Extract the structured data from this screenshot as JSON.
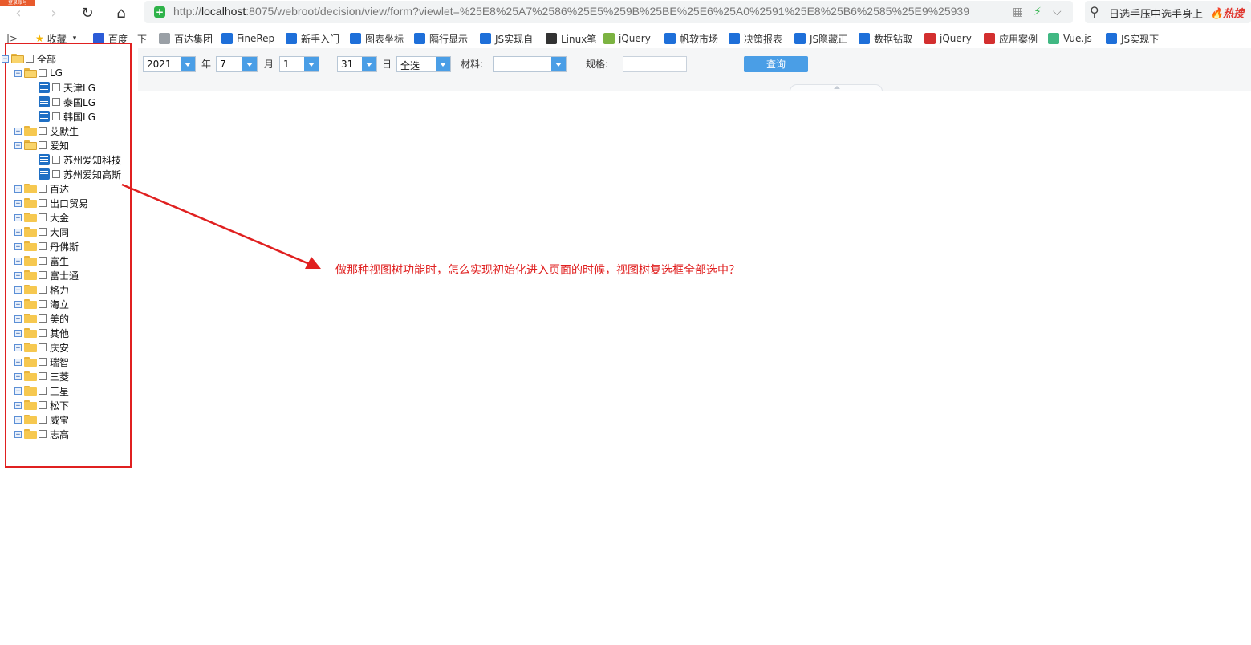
{
  "browser": {
    "login_badge": "登录账号",
    "url_prefix": "http://",
    "url_host": "localhost",
    "url_rest": ":8075/webroot/decision/view/form?viewlet=%25E8%25A7%2586%25E5%259B%25BE%25E6%25A0%2591%25E8%25B6%2585%25E9%25939",
    "search_text": "日选手压中选手身上",
    "search_hot": "🔥热搜"
  },
  "bookmarks": {
    "collect_label": "收藏",
    "items": [
      {
        "label": "百度一下",
        "color": "#2b5bd7"
      },
      {
        "label": "百达集团",
        "color": "#9aa0a6"
      },
      {
        "label": "FineRep",
        "color": "#1e6fd9"
      },
      {
        "label": "新手入门",
        "color": "#1e6fd9"
      },
      {
        "label": "图表坐标",
        "color": "#1e6fd9"
      },
      {
        "label": "隔行显示",
        "color": "#1e6fd9"
      },
      {
        "label": "JS实现自",
        "color": "#1e6fd9"
      },
      {
        "label": "Linux笔",
        "color": "#333333"
      },
      {
        "label": "jQuery",
        "color": "#7cb342"
      },
      {
        "label": "帆软市场",
        "color": "#1e6fd9"
      },
      {
        "label": "决策报表",
        "color": "#1e6fd9"
      },
      {
        "label": "JS隐藏正",
        "color": "#1e6fd9"
      },
      {
        "label": "数据钻取",
        "color": "#1e6fd9"
      },
      {
        "label": "jQuery",
        "color": "#d32f2f"
      },
      {
        "label": "应用案例",
        "color": "#d32f2f"
      },
      {
        "label": "Vue.js",
        "color": "#41b883"
      },
      {
        "label": "JS实现下",
        "color": "#1e6fd9"
      }
    ]
  },
  "tree": {
    "nodes": [
      {
        "label": "全部",
        "type": "root",
        "expander": "−"
      },
      {
        "label": "LG",
        "type": "folder-open",
        "expander": "−"
      },
      {
        "label": "天津LG",
        "type": "leaf"
      },
      {
        "label": "泰国LG",
        "type": "leaf"
      },
      {
        "label": "韩国LG",
        "type": "leaf"
      },
      {
        "label": "艾默生",
        "type": "folder",
        "expander": "+"
      },
      {
        "label": "爱知",
        "type": "folder-open",
        "expander": "−"
      },
      {
        "label": "苏州爱知科技",
        "type": "leaf"
      },
      {
        "label": "苏州爱知高斯",
        "type": "leaf"
      },
      {
        "label": "百达",
        "type": "folder",
        "expander": "+"
      },
      {
        "label": "出口贸易",
        "type": "folder",
        "expander": "+"
      },
      {
        "label": "大金",
        "type": "folder",
        "expander": "+"
      },
      {
        "label": "大同",
        "type": "folder",
        "expander": "+"
      },
      {
        "label": "丹佛斯",
        "type": "folder",
        "expander": "+"
      },
      {
        "label": "富生",
        "type": "folder",
        "expander": "+"
      },
      {
        "label": "富士通",
        "type": "folder",
        "expander": "+"
      },
      {
        "label": "格力",
        "type": "folder",
        "expander": "+"
      },
      {
        "label": "海立",
        "type": "folder",
        "expander": "+"
      },
      {
        "label": "美的",
        "type": "folder",
        "expander": "+"
      },
      {
        "label": "其他",
        "type": "folder",
        "expander": "+"
      },
      {
        "label": "庆安",
        "type": "folder",
        "expander": "+"
      },
      {
        "label": "瑞智",
        "type": "folder",
        "expander": "+"
      },
      {
        "label": "三菱",
        "type": "folder",
        "expander": "+"
      },
      {
        "label": "三星",
        "type": "folder",
        "expander": "+"
      },
      {
        "label": "松下",
        "type": "folder",
        "expander": "+"
      },
      {
        "label": "威宝",
        "type": "folder",
        "expander": "+"
      },
      {
        "label": "志高",
        "type": "folder",
        "expander": "+"
      }
    ]
  },
  "filters": {
    "year_value": "2021",
    "year_label": "年",
    "month_value": "7",
    "month_label": "月",
    "day_from_value": "1",
    "range_sep": "-",
    "day_to_value": "31",
    "day_label": "日",
    "select_all_value": "全选",
    "material_label": "材料:",
    "material_value": "",
    "spec_label": "规格:",
    "spec_value": "",
    "query_label": "查询"
  },
  "annotation": {
    "text": "做那种视图树功能时，怎么实现初始化进入页面的时候，视图树复选框全部选中？",
    "color": "#e02020"
  }
}
